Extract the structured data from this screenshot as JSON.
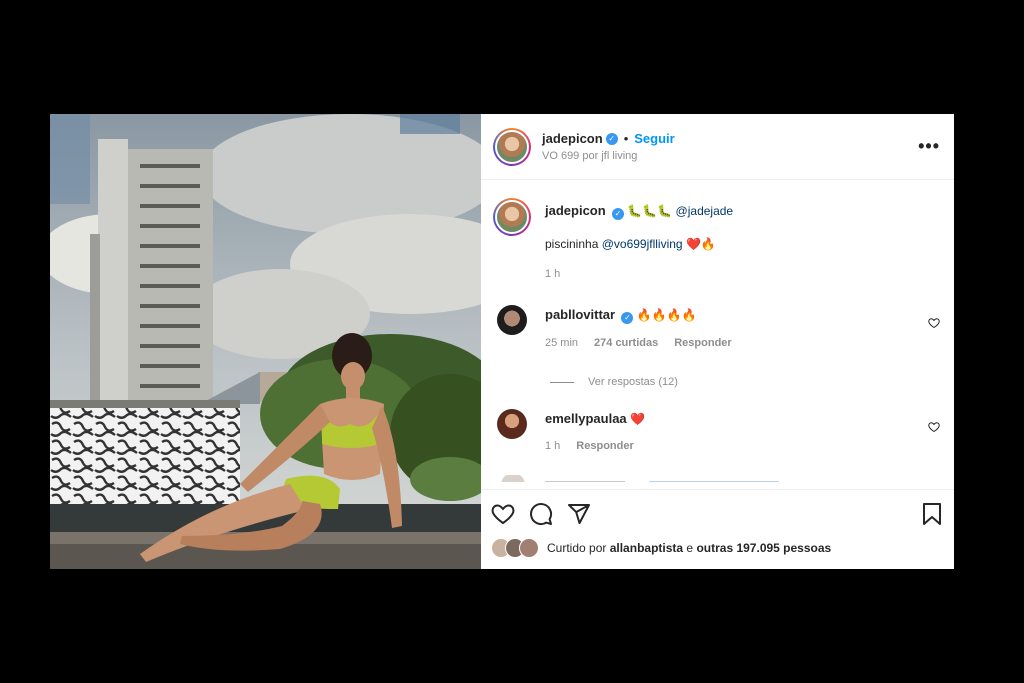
{
  "post": {
    "username": "jadepicon",
    "follow_label": "Seguir",
    "location": "VO 699 por jfl living"
  },
  "caption": {
    "username": "jadepicon",
    "emojis": "🐛🐛🐛",
    "mention": "@jadejade",
    "text": "piscininha",
    "text_mention": "@vo699jflliving",
    "text_emojis": "❤️🔥",
    "time": "1 h"
  },
  "comments": [
    {
      "username": "pabllovittar",
      "verified": true,
      "text": "🔥🔥🔥🔥",
      "time": "25 min",
      "likes": "274 curtidas",
      "reply": "Responder"
    },
    {
      "username": "emellypaulaa",
      "verified": false,
      "text": "❤️",
      "time": "1 h",
      "reply": "Responder"
    }
  ],
  "view_replies": "Ver respostas (12)",
  "liked_by": {
    "prefix": "Curtido por",
    "user": "allanbaptista",
    "middle": "e",
    "others": "outras 197.095 pessoas"
  },
  "icons": [
    "heart-icon",
    "comment-icon",
    "share-icon",
    "bookmark-icon",
    "more-options-icon",
    "verified-icon"
  ],
  "colors": {
    "accent": "#0095f6",
    "verified": "#3897f0",
    "text": "#262626",
    "muted": "#8e8e8e",
    "bikini": "#b5c935"
  }
}
